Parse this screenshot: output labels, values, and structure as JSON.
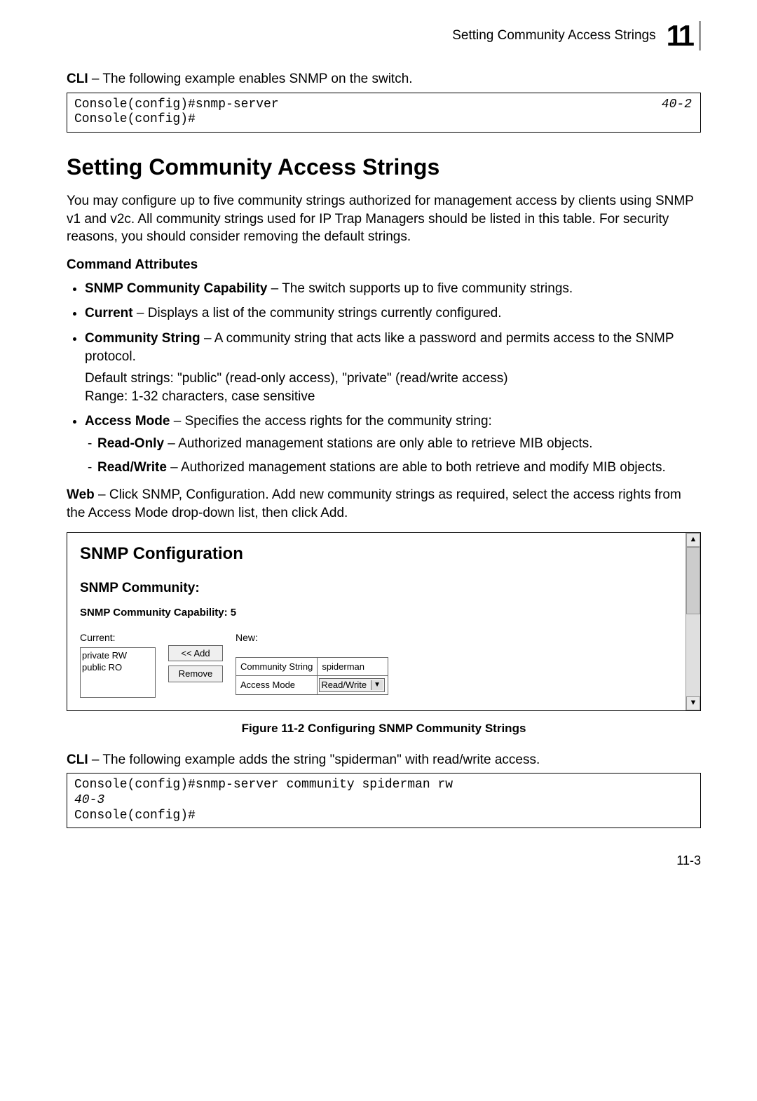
{
  "header": {
    "running_head": "Setting Community Access Strings",
    "chapter_number": "11"
  },
  "cli1": {
    "prefix": "CLI",
    "desc": " – The following example enables SNMP on the switch.",
    "line1": "Console(config)#snmp-server",
    "line2": "Console(config)#",
    "ref": "40-2"
  },
  "section_title": "Setting Community Access Strings",
  "intro": "You may configure up to five community strings authorized for management access by clients using SNMP v1 and v2c. All community strings used for IP Trap Managers should be listed in this table. For security reasons, you should consider removing the default strings.",
  "cmd_attr_heading": "Command Attributes",
  "bullets": {
    "b1_label": "SNMP Community Capability",
    "b1_text": " – The switch supports up to five community strings.",
    "b2_label": "Current",
    "b2_text": " – Displays a list of the community strings currently configured.",
    "b3_label": "Community String",
    "b3_text": " – A community string that acts like a password and permits access to the SNMP protocol.",
    "b3_sub1": "Default strings: \"public\" (read-only access), \"private\" (read/write access)",
    "b3_sub2": "Range: 1-32 characters, case sensitive",
    "b4_label": "Access Mode",
    "b4_text": " – Specifies the access rights for the community string:",
    "b4_s1_label": "Read-Only",
    "b4_s1_text": " – Authorized management stations are only able to retrieve MIB objects.",
    "b4_s2_label": "Read/Write",
    "b4_s2_text": " – Authorized management stations are able to both retrieve and modify MIB objects."
  },
  "web": {
    "prefix": "Web",
    "desc": " – Click SNMP, Configuration. Add new community strings as required, select the access rights from the Access Mode drop-down list, then click Add."
  },
  "screenshot": {
    "title": "SNMP Configuration",
    "h2": "SNMP Community:",
    "cap": "SNMP Community Capability: 5",
    "current_label": "Current:",
    "current_item1": "private RW",
    "current_item2": "public RO",
    "add_btn": "<< Add",
    "remove_btn": "Remove",
    "new_label": "New:",
    "cs_label": "Community String",
    "cs_value": "spiderman",
    "am_label": "Access Mode",
    "am_value": "Read/Write"
  },
  "figure_caption": "Figure 11-2  Configuring SNMP Community Strings",
  "cli2": {
    "prefix": "CLI",
    "desc": " – The following example adds the string \"spiderman\" with read/write access.",
    "line1": "Console(config)#snmp-server community spiderman rw",
    "ref": "40-3",
    "line2": "Console(config)#"
  },
  "page_number": "11-3"
}
